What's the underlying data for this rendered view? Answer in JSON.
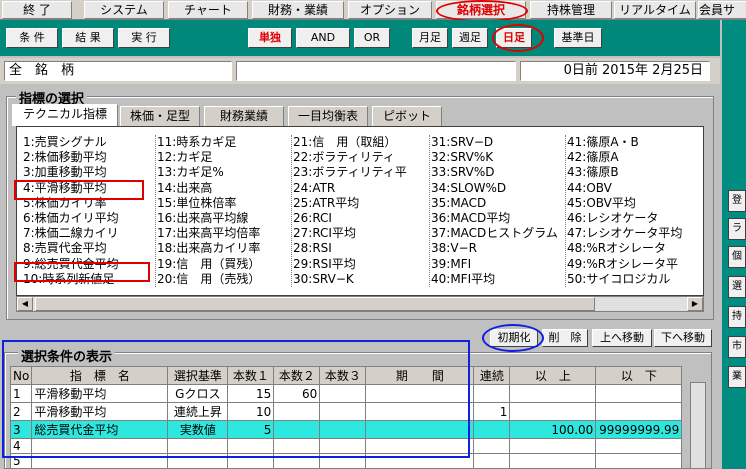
{
  "menubar": {
    "items": [
      "終 了",
      "システム",
      "チャート",
      "財務・業績",
      "オプション",
      "銘柄選択",
      "持株管理",
      "リアルタイム",
      "会員サ"
    ]
  },
  "toolbar": {
    "buttons": [
      "条 件",
      "結 果",
      "実 行",
      "単独",
      "AND",
      "OR",
      "月足",
      "週足",
      "日足",
      "基準日"
    ]
  },
  "header": {
    "stock_label": "全　銘　柄",
    "middle_field": "",
    "date_text": "0日前 2015年 2月25日"
  },
  "indicator_section": {
    "title": "指標の選択",
    "tabs": [
      "テクニカル指標",
      "株価・足型",
      "財務業績",
      "一目均衡表",
      "ピボット"
    ],
    "columns": [
      [
        "1:売買シグナル",
        "2:株価移動平均",
        "3:加重移動平均",
        "4:平滑移動平均",
        "5:株価カイリ率",
        "6:株価カイリ平均",
        "7:株価二線カイリ",
        "8:売買代金平均",
        "9:総売買代金平均",
        "10:時系列新値足"
      ],
      [
        "11:時系カギ足",
        "12:カギ足",
        "13:カギ足%",
        "14:出来高",
        "15:単位株倍率",
        "16:出来高平均線",
        "17:出来高平均倍率",
        "18:出来高カイリ率",
        "19:信　用（買残）",
        "20:信　用（売残）"
      ],
      [
        "21:信　用（取組）",
        "22:ボラティリティ",
        "23:ボラティリティ平",
        "24:ATR",
        "25:ATR平均",
        "26:RCI",
        "27:RCI平均",
        "28:RSI",
        "29:RSI平均",
        "30:SRV−K"
      ],
      [
        "31:SRV−D",
        "32:SRV%K",
        "33:SRV%D",
        "34:SLOW%D",
        "35:MACD",
        "36:MACD平均",
        "37:MACDヒストグラム",
        "38:V−R",
        "39:MFI",
        "40:MFI平均"
      ],
      [
        "41:篠原A・B",
        "42:篠原A",
        "43:篠原B",
        "44:OBV",
        "45:OBV平均",
        "46:レシオケータ",
        "47:レシオケータ平均",
        "48:%Rオシレータ",
        "49:%Rオシレータ平",
        "50:サイコロジカル"
      ]
    ]
  },
  "action_buttons": [
    "初期化",
    "削　除",
    "上へ移動",
    "下へ移動"
  ],
  "conditions": {
    "title": "選択条件の表示",
    "headers": [
      "No",
      "指　標　名",
      "選択基準",
      "本数１",
      "本数２",
      "本数３",
      "期　　間",
      "連続",
      "以　上",
      "以　下"
    ],
    "rows": [
      [
        "1",
        "平滑移動平均",
        "Gクロス",
        "15",
        "60",
        "",
        "",
        "",
        "",
        ""
      ],
      [
        "2",
        "平滑移動平均",
        "連続上昇",
        "10",
        "",
        "",
        "",
        "1",
        "",
        ""
      ],
      [
        "3",
        "総売買代金平均",
        "実数値",
        "5",
        "",
        "",
        "",
        "",
        "100.00",
        "99999999.99"
      ],
      [
        "4",
        "",
        "",
        "",
        "",
        "",
        "",
        "",
        "",
        ""
      ],
      [
        "5",
        "",
        "",
        "",
        "",
        "",
        "",
        "",
        "",
        ""
      ]
    ]
  },
  "right_panel": {
    "labels": [
      "登",
      "ラ",
      "個",
      "選",
      "持",
      "市",
      "業"
    ]
  },
  "colors": {
    "teal": "#00887a",
    "highlight_row": "#2ee8e0",
    "annotation_red": "#e00000",
    "annotation_blue": "#1020e0"
  }
}
